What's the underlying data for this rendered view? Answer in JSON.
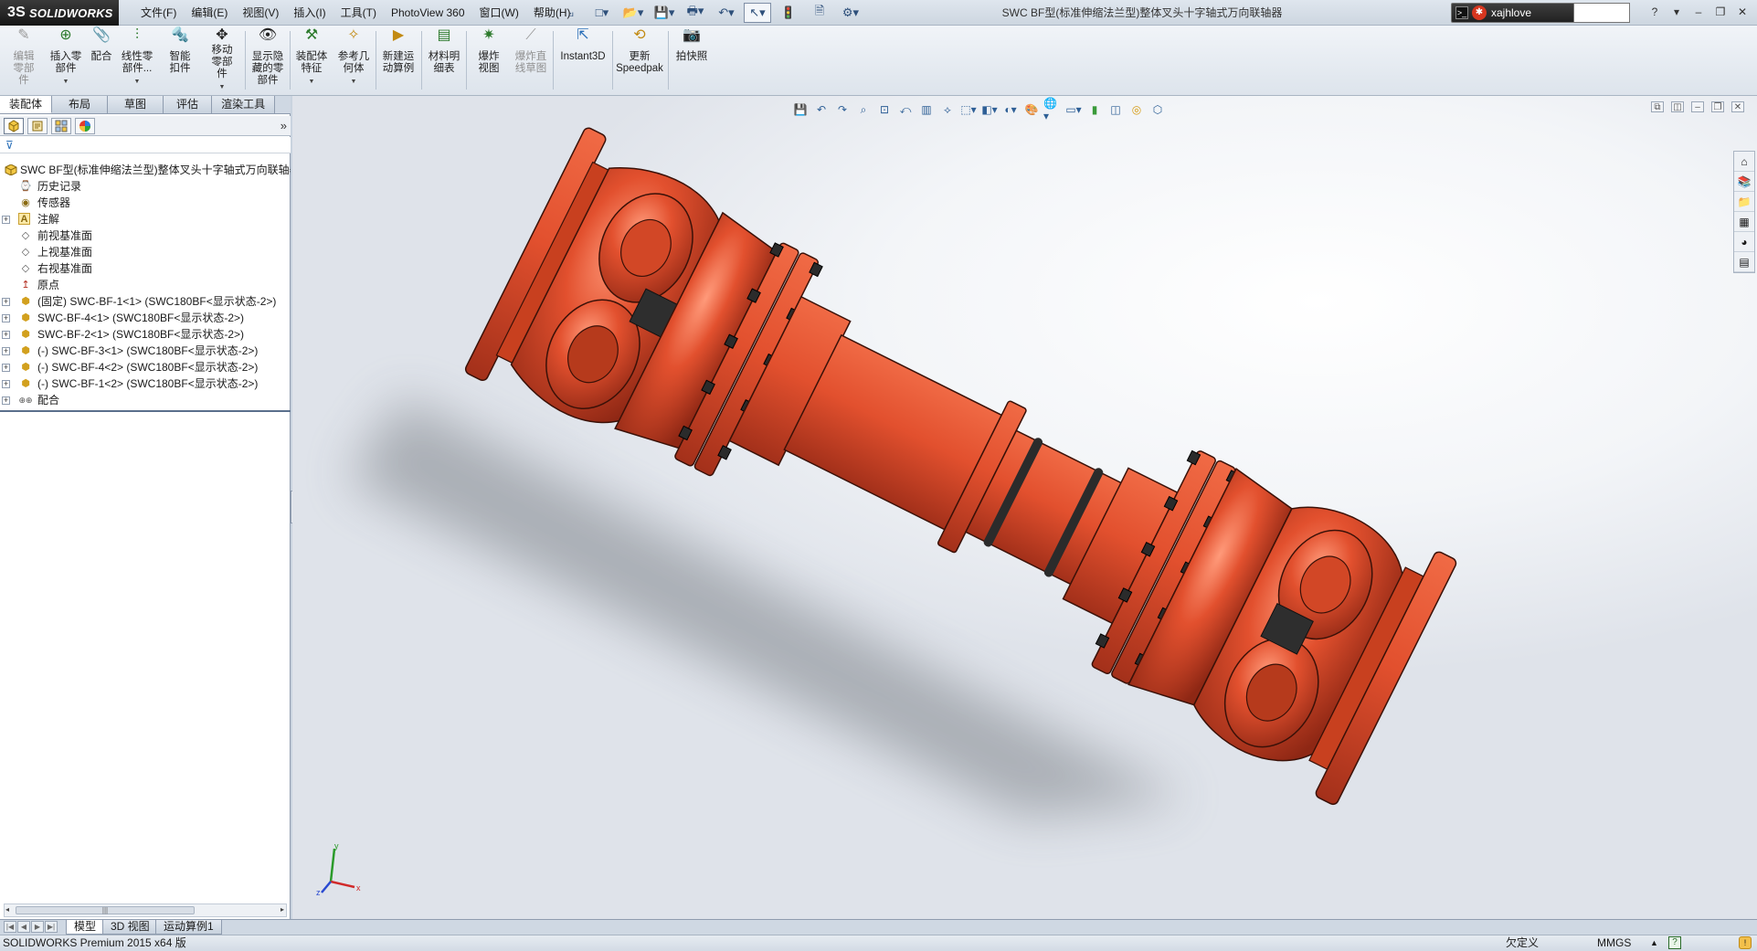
{
  "app": {
    "logo_ds": "3S",
    "logo_text": "SOLIDWORKS",
    "doc_title": "SWC BF型(标准伸缩法兰型)整体叉头十字轴式万向联轴器",
    "colors": {
      "part": "#e2502e",
      "part_dark": "#b8361a",
      "bolt": "#2b2b2b",
      "accent_blue": "#2a6fb8"
    }
  },
  "menu": [
    "文件(F)",
    "编辑(E)",
    "视图(V)",
    "插入(I)",
    "工具(T)",
    "PhotoView 360",
    "窗口(W)",
    "帮助(H)"
  ],
  "quick_tools": [
    {
      "icon": "pin-icon",
      "glyph": "⟓"
    },
    {
      "icon": "new-doc-icon",
      "glyph": "□▾"
    },
    {
      "icon": "open-icon",
      "glyph": "📂▾"
    },
    {
      "icon": "save-icon",
      "glyph": "💾▾"
    },
    {
      "icon": "print-icon",
      "glyph": "🖶▾"
    },
    {
      "icon": "undo-icon",
      "glyph": "↶▾"
    },
    {
      "icon": "select-icon",
      "glyph": "↖▾"
    },
    {
      "icon": "rebuild-icon",
      "glyph": "🚦"
    },
    {
      "icon": "file-props-icon",
      "glyph": "🗎"
    },
    {
      "icon": "options-icon",
      "glyph": "⚙▾"
    }
  ],
  "user": {
    "name": "xajhlove",
    "terminal_glyph": ">_",
    "avatar_glyph": "✱",
    "dropdown": "▼"
  },
  "window_controls": [
    "?",
    "▾",
    "–",
    "❐",
    "✕"
  ],
  "ribbon": [
    {
      "id": "edit-component",
      "label": "编辑零部件",
      "disabled": true,
      "icon": "✎"
    },
    {
      "id": "insert-component",
      "label": "插入零部件",
      "disabled": false,
      "icon": "⊕",
      "dropdown": true
    },
    {
      "id": "mate",
      "label": "配合",
      "disabled": false,
      "icon": "📎"
    },
    {
      "id": "linear-pattern",
      "label": "线性零部件...",
      "disabled": false,
      "icon": "⫶",
      "dropdown": true
    },
    {
      "id": "smart-fasteners",
      "label": "智能扣件",
      "disabled": false,
      "icon": "🔩"
    },
    {
      "id": "move-component",
      "label": "移动零部件",
      "disabled": false,
      "icon": "✥",
      "dropdown": true
    },
    {
      "id": "show-hidden",
      "label": "显示隐藏的零部件",
      "disabled": false,
      "icon": "👁"
    },
    {
      "id": "assembly-features",
      "label": "装配体特征",
      "disabled": false,
      "icon": "⚒",
      "dropdown": true
    },
    {
      "id": "reference-geometry",
      "label": "参考几何体",
      "disabled": false,
      "icon": "✧",
      "dropdown": true
    },
    {
      "id": "new-motion-study",
      "label": "新建运动算例",
      "disabled": false,
      "icon": "▶"
    },
    {
      "id": "bill-of-materials",
      "label": "材料明细表",
      "disabled": false,
      "icon": "▤"
    },
    {
      "id": "exploded-view",
      "label": "爆炸视图",
      "disabled": false,
      "icon": "✷"
    },
    {
      "id": "explode-line-sketch",
      "label": "爆炸直线草图",
      "disabled": true,
      "icon": "⟋"
    },
    {
      "id": "instant3d",
      "label": "Instant3D",
      "disabled": false,
      "icon": "⇱"
    },
    {
      "id": "update-speedpak",
      "label": "更新Speedpak",
      "disabled": false,
      "icon": "⟲"
    },
    {
      "id": "take-snapshot",
      "label": "拍快照",
      "disabled": false,
      "icon": "📷"
    }
  ],
  "cm_tabs": [
    "装配体",
    "布局",
    "草图",
    "评估",
    "渲染工具"
  ],
  "fm_tabs": [
    "featuremanager-icon",
    "propertymanager-icon",
    "configmanager-icon",
    "displaymanager-icon"
  ],
  "fm_expand": "»",
  "filter_glyph": "⊽",
  "tree": {
    "root": "SWC BF型(标准伸缩法兰型)整体叉头十字轴式万向联轴器",
    "items": [
      {
        "label": "历史记录",
        "icon": "history-icon",
        "glyph": "⌚",
        "expandable": false
      },
      {
        "label": "传感器",
        "icon": "sensor-icon",
        "glyph": "◉",
        "expandable": false
      },
      {
        "label": "注解",
        "icon": "annotation-icon",
        "glyph": "A",
        "expandable": true
      },
      {
        "label": "前视基准面",
        "icon": "plane-icon",
        "glyph": "◇",
        "expandable": false
      },
      {
        "label": "上视基准面",
        "icon": "plane-icon",
        "glyph": "◇",
        "expandable": false
      },
      {
        "label": "右视基准面",
        "icon": "plane-icon",
        "glyph": "◇",
        "expandable": false
      },
      {
        "label": "原点",
        "icon": "origin-icon",
        "glyph": "↥",
        "expandable": false
      },
      {
        "label": "(固定) SWC-BF-1<1> (SWC180BF<显示状态-2>)",
        "icon": "subassembly-icon",
        "glyph": "⬢",
        "expandable": true
      },
      {
        "label": "SWC-BF-4<1> (SWC180BF<显示状态-2>)",
        "icon": "subassembly-icon",
        "glyph": "⬢",
        "expandable": true
      },
      {
        "label": "SWC-BF-2<1> (SWC180BF<显示状态-2>)",
        "icon": "subassembly-icon",
        "glyph": "⬢",
        "expandable": true
      },
      {
        "label": "(-) SWC-BF-3<1> (SWC180BF<显示状态-2>)",
        "icon": "subassembly-icon",
        "glyph": "⬢",
        "expandable": true
      },
      {
        "label": "(-) SWC-BF-4<2> (SWC180BF<显示状态-2>)",
        "icon": "subassembly-icon",
        "glyph": "⬢",
        "expandable": true
      },
      {
        "label": "(-) SWC-BF-1<2> (SWC180BF<显示状态-2>)",
        "icon": "subassembly-icon",
        "glyph": "⬢",
        "expandable": true
      },
      {
        "label": "配合",
        "icon": "mates-icon",
        "glyph": "⊕⊕",
        "expandable": true
      }
    ]
  },
  "heads_up_toolbar": [
    {
      "icon": "save-view-icon",
      "glyph": "💾"
    },
    {
      "icon": "undo-view-icon",
      "glyph": "↶"
    },
    {
      "icon": "redo-view-icon",
      "glyph": "↷"
    },
    {
      "icon": "zoom-to-fit-icon",
      "glyph": "⌕"
    },
    {
      "icon": "zoom-area-icon",
      "glyph": "⊡"
    },
    {
      "icon": "previous-view-icon",
      "glyph": "⤺"
    },
    {
      "icon": "section-view-icon",
      "glyph": "▥"
    },
    {
      "icon": "dynamic-annotation-icon",
      "glyph": "⟡"
    },
    {
      "icon": "view-orientation-icon",
      "glyph": "⬚▾"
    },
    {
      "icon": "display-style-icon",
      "glyph": "◧▾"
    },
    {
      "icon": "hide-show-icon",
      "glyph": "◐▾"
    },
    {
      "icon": "edit-appearance-icon",
      "glyph": "🎨"
    },
    {
      "icon": "apply-scene-icon",
      "glyph": "🌐▾"
    },
    {
      "icon": "view-settings-icon",
      "glyph": "▭▾"
    },
    {
      "icon": "realview-icon",
      "glyph": "▮"
    },
    {
      "icon": "camera-icon",
      "glyph": "◫"
    },
    {
      "icon": "photoview-icon",
      "glyph": "◎"
    },
    {
      "icon": "3d-view-icon",
      "glyph": "⬡"
    }
  ],
  "viewport_controls": [
    "⧉",
    "◫",
    "–",
    "❐",
    "✕"
  ],
  "task_pane": [
    {
      "icon": "sw-resources-icon",
      "glyph": "⌂"
    },
    {
      "icon": "design-library-icon",
      "glyph": "📚"
    },
    {
      "icon": "file-explorer-icon",
      "glyph": "📁"
    },
    {
      "icon": "view-palette-icon",
      "glyph": "▦"
    },
    {
      "icon": "appearances-icon",
      "glyph": "◕"
    },
    {
      "icon": "custom-props-icon",
      "glyph": "▤"
    }
  ],
  "bottom_tabs": [
    "模型",
    "3D 视图",
    "运动算例1"
  ],
  "bottom_nav": [
    "|◀",
    "◀",
    "▶",
    "▶|"
  ],
  "status": {
    "product": "SOLIDWORKS Premium 2015 x64 版",
    "definition": "欠定义",
    "units": "MMGS",
    "units_arrow": "▲",
    "help": "?",
    "rebuild_glyph": "!"
  },
  "triad": {
    "x": "x",
    "y": "y",
    "z": "z"
  }
}
